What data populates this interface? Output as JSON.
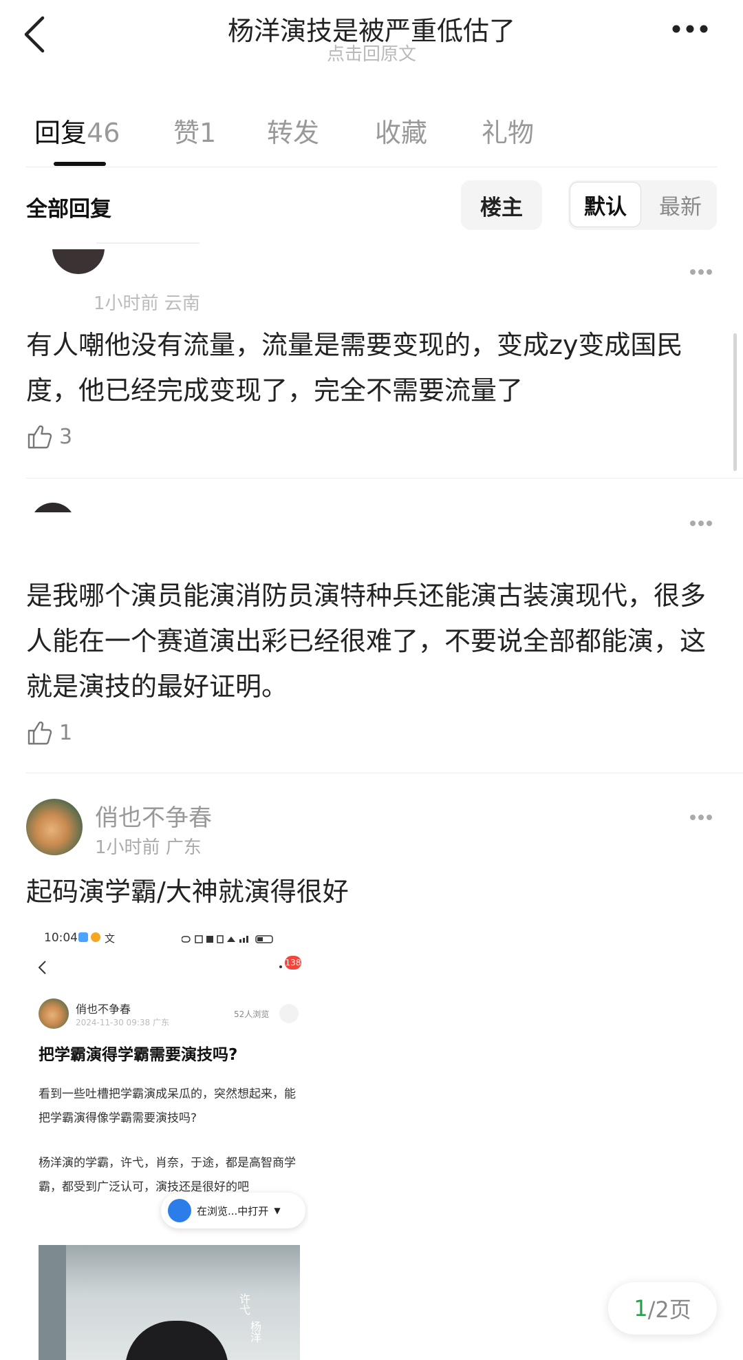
{
  "header": {
    "title": "杨洋演技是被严重低估了",
    "subtitle": "点击回原文"
  },
  "tabs": [
    {
      "label": "回复",
      "count": "46"
    },
    {
      "label": "赞",
      "count": "1"
    },
    {
      "label": "转发"
    },
    {
      "label": "收藏"
    },
    {
      "label": "礼物"
    }
  ],
  "filter": {
    "title": "全部回复",
    "op_button": "楼主",
    "sort_default": "默认",
    "sort_latest": "最新"
  },
  "comments": [
    {
      "meta": "1小时前 云南",
      "text": "有人嘲他没有流量，流量是需要变现的，变成zy变成国民度，他已经完成变现了，完全不需要流量了",
      "likes": "3"
    },
    {
      "text": "是我哪个演员能演消防员演特种兵还能演古装演现代，很多人能在一个赛道演出彩已经很难了，不要说全部都能演，这就是演技的最好证明。",
      "likes": "1"
    },
    {
      "username": "俏也不争春",
      "meta": "1小时前 广东",
      "text": "起码演学霸/大神就演得很好"
    }
  ],
  "embedded_screenshot": {
    "time": "10:04",
    "status_icons": "文",
    "badge": "138",
    "username": "俏也不争春",
    "meta": "2024-11-30 09:38 广东",
    "views": "52人浏览",
    "title": "把学霸演得学霸需要演技吗?",
    "para1": "看到一些吐槽把学霸演成呆瓜的，突然想起来，能把学霸演得像学霸需要演技吗?",
    "para2": "杨洋演的学霸，许弋，肖奈，于途，都是高智商学霸，都受到广泛认可，演技还是很好的吧",
    "browser_prompt": "在浏览...中打开",
    "image_caption_1": "许弋",
    "image_caption_2": "杨洋"
  },
  "pager": {
    "current": "1",
    "total": "/2页"
  }
}
